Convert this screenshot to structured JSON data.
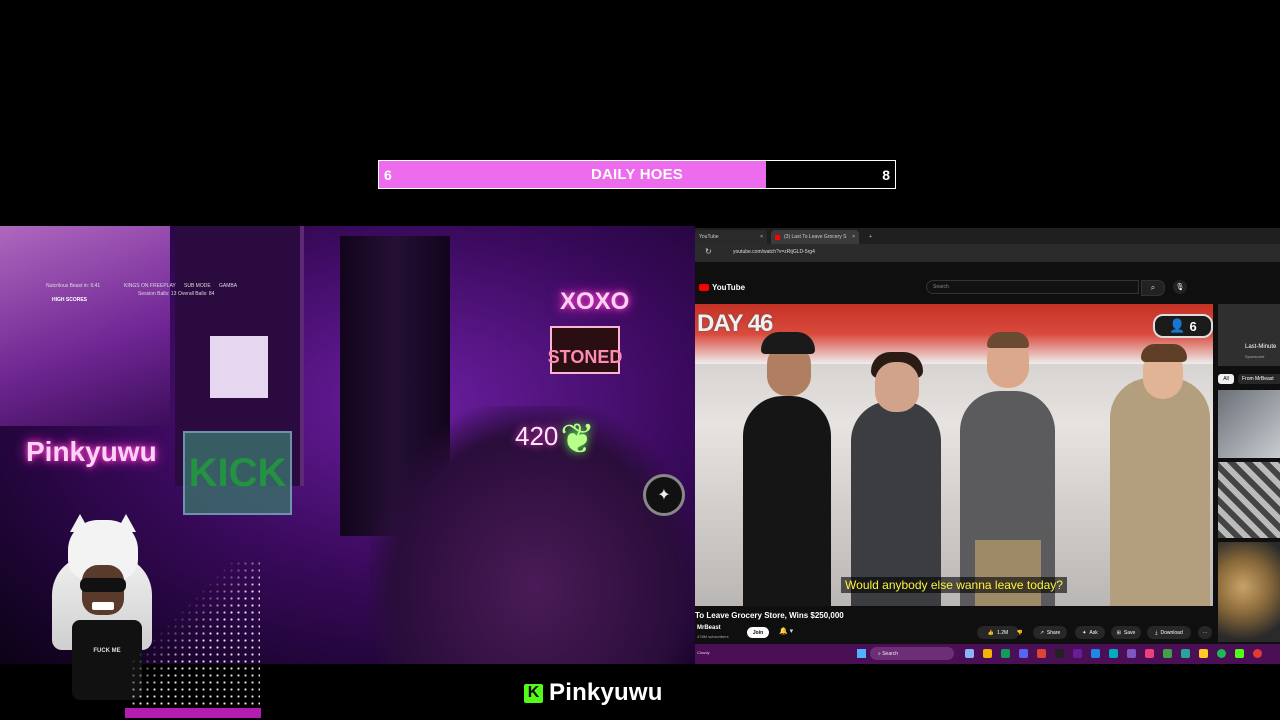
{
  "goal": {
    "title": "DAILY HOES",
    "current": "6",
    "target": "8",
    "progress_fraction": 0.75,
    "fill_color": "#ec6ced"
  },
  "cam": {
    "neon_pinkyuwu": "Pinkyuwu",
    "neon_xoxo": "XOXO",
    "neon_stoned": "STONED",
    "neon_420": "420",
    "kick_sign": "KICK",
    "scoreboard": {
      "title": "Nutcrilous Beast in: 6:41",
      "high_scores": "HIGH SCORES",
      "labels": [
        "KINGS ON",
        "FREEPLAY",
        "SUB MODE",
        "GAMBA"
      ],
      "row2": [
        "Session Balls: 13",
        "Overall Balls: 84"
      ]
    },
    "avatar_shirt": "FUCK ME"
  },
  "channel": {
    "platform_icon": "kick-logo",
    "logo_letter": "K",
    "name": "Pinkyuwu",
    "accent": "#53fc18"
  },
  "browser": {
    "tabs": [
      {
        "label": "YouTube"
      },
      {
        "label": "(3) Last To Leave Grocery S"
      }
    ],
    "new_tab": "+",
    "url": "youtube.com/watch?v=zRtjGLD-5rg4",
    "yt_logo": "YouTube",
    "search_placeholder": "Search",
    "video": {
      "overlay_day": "DAY 46",
      "counter": "6",
      "caption": "Would anybody else wanna leave today?",
      "title": "To Leave Grocery Store, Wins $250,000",
      "channel": "MrBeast",
      "subs": "478M subscribers",
      "join": "Join",
      "actions": [
        {
          "icon": "like-icon",
          "label": "1.2M"
        },
        {
          "icon": "dislike-icon",
          "label": ""
        },
        {
          "icon": "share-icon",
          "label": "Share"
        },
        {
          "icon": "ask-icon",
          "label": "Ask"
        },
        {
          "icon": "save-icon",
          "label": "Save"
        },
        {
          "icon": "download-icon",
          "label": "Download"
        }
      ]
    },
    "sidebar": {
      "ad_title": "Last-Minute",
      "ad_sponsored": "Sponsored",
      "chips": [
        "All",
        "From MrBeast"
      ]
    },
    "taskbar": {
      "search": "Search",
      "left_text": "Cloudy"
    }
  }
}
